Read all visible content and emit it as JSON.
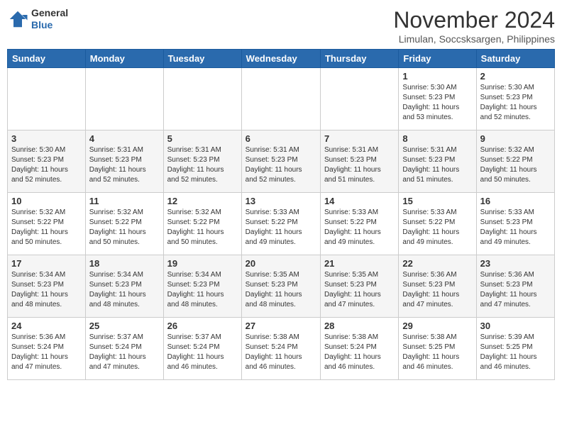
{
  "header": {
    "logo_general": "General",
    "logo_blue": "Blue",
    "month": "November 2024",
    "location": "Limulan, Soccsksargen, Philippines"
  },
  "days_of_week": [
    "Sunday",
    "Monday",
    "Tuesday",
    "Wednesday",
    "Thursday",
    "Friday",
    "Saturday"
  ],
  "weeks": [
    [
      {
        "day": "",
        "info": ""
      },
      {
        "day": "",
        "info": ""
      },
      {
        "day": "",
        "info": ""
      },
      {
        "day": "",
        "info": ""
      },
      {
        "day": "",
        "info": ""
      },
      {
        "day": "1",
        "info": "Sunrise: 5:30 AM\nSunset: 5:23 PM\nDaylight: 11 hours\nand 53 minutes."
      },
      {
        "day": "2",
        "info": "Sunrise: 5:30 AM\nSunset: 5:23 PM\nDaylight: 11 hours\nand 52 minutes."
      }
    ],
    [
      {
        "day": "3",
        "info": "Sunrise: 5:30 AM\nSunset: 5:23 PM\nDaylight: 11 hours\nand 52 minutes."
      },
      {
        "day": "4",
        "info": "Sunrise: 5:31 AM\nSunset: 5:23 PM\nDaylight: 11 hours\nand 52 minutes."
      },
      {
        "day": "5",
        "info": "Sunrise: 5:31 AM\nSunset: 5:23 PM\nDaylight: 11 hours\nand 52 minutes."
      },
      {
        "day": "6",
        "info": "Sunrise: 5:31 AM\nSunset: 5:23 PM\nDaylight: 11 hours\nand 52 minutes."
      },
      {
        "day": "7",
        "info": "Sunrise: 5:31 AM\nSunset: 5:23 PM\nDaylight: 11 hours\nand 51 minutes."
      },
      {
        "day": "8",
        "info": "Sunrise: 5:31 AM\nSunset: 5:23 PM\nDaylight: 11 hours\nand 51 minutes."
      },
      {
        "day": "9",
        "info": "Sunrise: 5:32 AM\nSunset: 5:22 PM\nDaylight: 11 hours\nand 50 minutes."
      }
    ],
    [
      {
        "day": "10",
        "info": "Sunrise: 5:32 AM\nSunset: 5:22 PM\nDaylight: 11 hours\nand 50 minutes."
      },
      {
        "day": "11",
        "info": "Sunrise: 5:32 AM\nSunset: 5:22 PM\nDaylight: 11 hours\nand 50 minutes."
      },
      {
        "day": "12",
        "info": "Sunrise: 5:32 AM\nSunset: 5:22 PM\nDaylight: 11 hours\nand 50 minutes."
      },
      {
        "day": "13",
        "info": "Sunrise: 5:33 AM\nSunset: 5:22 PM\nDaylight: 11 hours\nand 49 minutes."
      },
      {
        "day": "14",
        "info": "Sunrise: 5:33 AM\nSunset: 5:22 PM\nDaylight: 11 hours\nand 49 minutes."
      },
      {
        "day": "15",
        "info": "Sunrise: 5:33 AM\nSunset: 5:22 PM\nDaylight: 11 hours\nand 49 minutes."
      },
      {
        "day": "16",
        "info": "Sunrise: 5:33 AM\nSunset: 5:23 PM\nDaylight: 11 hours\nand 49 minutes."
      }
    ],
    [
      {
        "day": "17",
        "info": "Sunrise: 5:34 AM\nSunset: 5:23 PM\nDaylight: 11 hours\nand 48 minutes."
      },
      {
        "day": "18",
        "info": "Sunrise: 5:34 AM\nSunset: 5:23 PM\nDaylight: 11 hours\nand 48 minutes."
      },
      {
        "day": "19",
        "info": "Sunrise: 5:34 AM\nSunset: 5:23 PM\nDaylight: 11 hours\nand 48 minutes."
      },
      {
        "day": "20",
        "info": "Sunrise: 5:35 AM\nSunset: 5:23 PM\nDaylight: 11 hours\nand 48 minutes."
      },
      {
        "day": "21",
        "info": "Sunrise: 5:35 AM\nSunset: 5:23 PM\nDaylight: 11 hours\nand 47 minutes."
      },
      {
        "day": "22",
        "info": "Sunrise: 5:36 AM\nSunset: 5:23 PM\nDaylight: 11 hours\nand 47 minutes."
      },
      {
        "day": "23",
        "info": "Sunrise: 5:36 AM\nSunset: 5:23 PM\nDaylight: 11 hours\nand 47 minutes."
      }
    ],
    [
      {
        "day": "24",
        "info": "Sunrise: 5:36 AM\nSunset: 5:24 PM\nDaylight: 11 hours\nand 47 minutes."
      },
      {
        "day": "25",
        "info": "Sunrise: 5:37 AM\nSunset: 5:24 PM\nDaylight: 11 hours\nand 47 minutes."
      },
      {
        "day": "26",
        "info": "Sunrise: 5:37 AM\nSunset: 5:24 PM\nDaylight: 11 hours\nand 46 minutes."
      },
      {
        "day": "27",
        "info": "Sunrise: 5:38 AM\nSunset: 5:24 PM\nDaylight: 11 hours\nand 46 minutes."
      },
      {
        "day": "28",
        "info": "Sunrise: 5:38 AM\nSunset: 5:24 PM\nDaylight: 11 hours\nand 46 minutes."
      },
      {
        "day": "29",
        "info": "Sunrise: 5:38 AM\nSunset: 5:25 PM\nDaylight: 11 hours\nand 46 minutes."
      },
      {
        "day": "30",
        "info": "Sunrise: 5:39 AM\nSunset: 5:25 PM\nDaylight: 11 hours\nand 46 minutes."
      }
    ]
  ]
}
